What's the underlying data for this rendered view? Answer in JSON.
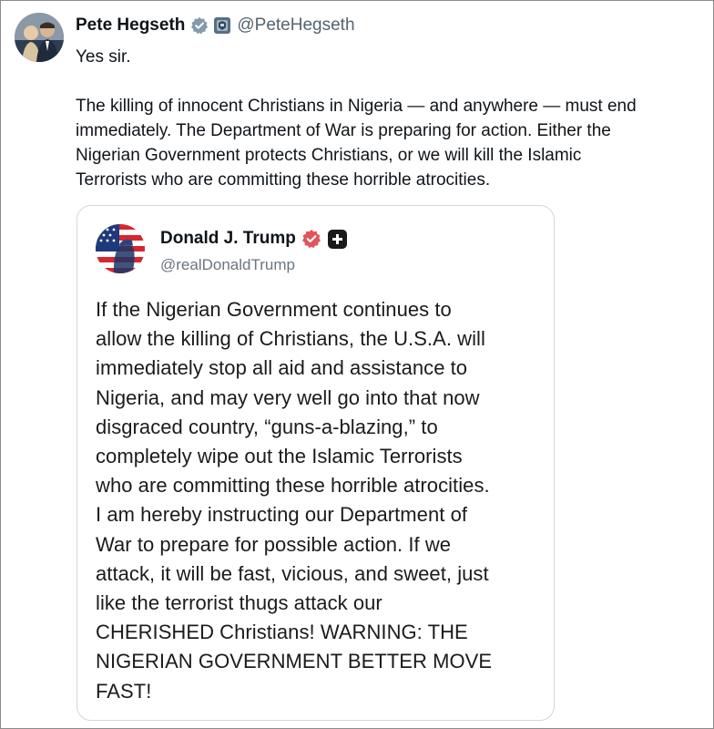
{
  "tweet": {
    "author_name": "Pete Hegseth",
    "author_handle": "@PeteHegseth",
    "lines": [
      "Yes sir.",
      "",
      "The killing of innocent Christians in Nigeria — and anywhere — must end",
      "immediately. The Department of War is preparing for action. Either the",
      "Nigerian Government protects Christians, or we will kill the Islamic",
      "Terrorists who are committing these horrible atrocities."
    ]
  },
  "quote": {
    "author_name": "Donald J. Trump",
    "author_handle": "@realDonaldTrump",
    "lines": [
      "If the Nigerian Government continues to",
      "allow the killing of Christians, the U.S.A. will",
      "immediately stop all aid and assistance to",
      "Nigeria, and may very well go into that now",
      "disgraced country, “guns-a-blazing,” to",
      "completely wipe out the Islamic Terrorists",
      "who are committing these horrible atrocities.",
      "I am hereby instructing our Department of",
      "War to prepare for possible action. If we",
      "attack, it will be fast, vicious, and sweet, just",
      "like the terrorist thugs attack our",
      "CHERISHED Christians! WARNING: THE",
      "NIGERIAN GOVERNMENT BETTER MOVE",
      "FAST!"
    ]
  },
  "icons": {
    "author_verified": "verified-badge-icon",
    "author_affiliation": "affiliation-badge-icon",
    "quote_verified": "verified-badge-red-icon",
    "quote_plus": "plus-badge-icon"
  },
  "colors": {
    "text": "#0f1419",
    "secondary_text": "#536471",
    "verified_gray": "#829aab",
    "verified_red": "#e2545b",
    "card_border": "#cfd9de"
  }
}
